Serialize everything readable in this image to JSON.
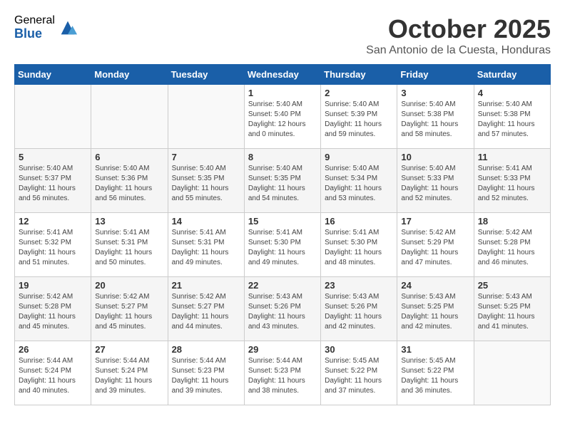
{
  "logo": {
    "general": "General",
    "blue": "Blue"
  },
  "title": "October 2025",
  "location": "San Antonio de la Cuesta, Honduras",
  "days_header": [
    "Sunday",
    "Monday",
    "Tuesday",
    "Wednesday",
    "Thursday",
    "Friday",
    "Saturday"
  ],
  "weeks": [
    [
      {
        "day": "",
        "info": ""
      },
      {
        "day": "",
        "info": ""
      },
      {
        "day": "",
        "info": ""
      },
      {
        "day": "1",
        "info": "Sunrise: 5:40 AM\nSunset: 5:40 PM\nDaylight: 12 hours\nand 0 minutes."
      },
      {
        "day": "2",
        "info": "Sunrise: 5:40 AM\nSunset: 5:39 PM\nDaylight: 11 hours\nand 59 minutes."
      },
      {
        "day": "3",
        "info": "Sunrise: 5:40 AM\nSunset: 5:38 PM\nDaylight: 11 hours\nand 58 minutes."
      },
      {
        "day": "4",
        "info": "Sunrise: 5:40 AM\nSunset: 5:38 PM\nDaylight: 11 hours\nand 57 minutes."
      }
    ],
    [
      {
        "day": "5",
        "info": "Sunrise: 5:40 AM\nSunset: 5:37 PM\nDaylight: 11 hours\nand 56 minutes."
      },
      {
        "day": "6",
        "info": "Sunrise: 5:40 AM\nSunset: 5:36 PM\nDaylight: 11 hours\nand 56 minutes."
      },
      {
        "day": "7",
        "info": "Sunrise: 5:40 AM\nSunset: 5:35 PM\nDaylight: 11 hours\nand 55 minutes."
      },
      {
        "day": "8",
        "info": "Sunrise: 5:40 AM\nSunset: 5:35 PM\nDaylight: 11 hours\nand 54 minutes."
      },
      {
        "day": "9",
        "info": "Sunrise: 5:40 AM\nSunset: 5:34 PM\nDaylight: 11 hours\nand 53 minutes."
      },
      {
        "day": "10",
        "info": "Sunrise: 5:40 AM\nSunset: 5:33 PM\nDaylight: 11 hours\nand 52 minutes."
      },
      {
        "day": "11",
        "info": "Sunrise: 5:41 AM\nSunset: 5:33 PM\nDaylight: 11 hours\nand 52 minutes."
      }
    ],
    [
      {
        "day": "12",
        "info": "Sunrise: 5:41 AM\nSunset: 5:32 PM\nDaylight: 11 hours\nand 51 minutes."
      },
      {
        "day": "13",
        "info": "Sunrise: 5:41 AM\nSunset: 5:31 PM\nDaylight: 11 hours\nand 50 minutes."
      },
      {
        "day": "14",
        "info": "Sunrise: 5:41 AM\nSunset: 5:31 PM\nDaylight: 11 hours\nand 49 minutes."
      },
      {
        "day": "15",
        "info": "Sunrise: 5:41 AM\nSunset: 5:30 PM\nDaylight: 11 hours\nand 49 minutes."
      },
      {
        "day": "16",
        "info": "Sunrise: 5:41 AM\nSunset: 5:30 PM\nDaylight: 11 hours\nand 48 minutes."
      },
      {
        "day": "17",
        "info": "Sunrise: 5:42 AM\nSunset: 5:29 PM\nDaylight: 11 hours\nand 47 minutes."
      },
      {
        "day": "18",
        "info": "Sunrise: 5:42 AM\nSunset: 5:28 PM\nDaylight: 11 hours\nand 46 minutes."
      }
    ],
    [
      {
        "day": "19",
        "info": "Sunrise: 5:42 AM\nSunset: 5:28 PM\nDaylight: 11 hours\nand 45 minutes."
      },
      {
        "day": "20",
        "info": "Sunrise: 5:42 AM\nSunset: 5:27 PM\nDaylight: 11 hours\nand 45 minutes."
      },
      {
        "day": "21",
        "info": "Sunrise: 5:42 AM\nSunset: 5:27 PM\nDaylight: 11 hours\nand 44 minutes."
      },
      {
        "day": "22",
        "info": "Sunrise: 5:43 AM\nSunset: 5:26 PM\nDaylight: 11 hours\nand 43 minutes."
      },
      {
        "day": "23",
        "info": "Sunrise: 5:43 AM\nSunset: 5:26 PM\nDaylight: 11 hours\nand 42 minutes."
      },
      {
        "day": "24",
        "info": "Sunrise: 5:43 AM\nSunset: 5:25 PM\nDaylight: 11 hours\nand 42 minutes."
      },
      {
        "day": "25",
        "info": "Sunrise: 5:43 AM\nSunset: 5:25 PM\nDaylight: 11 hours\nand 41 minutes."
      }
    ],
    [
      {
        "day": "26",
        "info": "Sunrise: 5:44 AM\nSunset: 5:24 PM\nDaylight: 11 hours\nand 40 minutes."
      },
      {
        "day": "27",
        "info": "Sunrise: 5:44 AM\nSunset: 5:24 PM\nDaylight: 11 hours\nand 39 minutes."
      },
      {
        "day": "28",
        "info": "Sunrise: 5:44 AM\nSunset: 5:23 PM\nDaylight: 11 hours\nand 39 minutes."
      },
      {
        "day": "29",
        "info": "Sunrise: 5:44 AM\nSunset: 5:23 PM\nDaylight: 11 hours\nand 38 minutes."
      },
      {
        "day": "30",
        "info": "Sunrise: 5:45 AM\nSunset: 5:22 PM\nDaylight: 11 hours\nand 37 minutes."
      },
      {
        "day": "31",
        "info": "Sunrise: 5:45 AM\nSunset: 5:22 PM\nDaylight: 11 hours\nand 36 minutes."
      },
      {
        "day": "",
        "info": ""
      }
    ]
  ]
}
